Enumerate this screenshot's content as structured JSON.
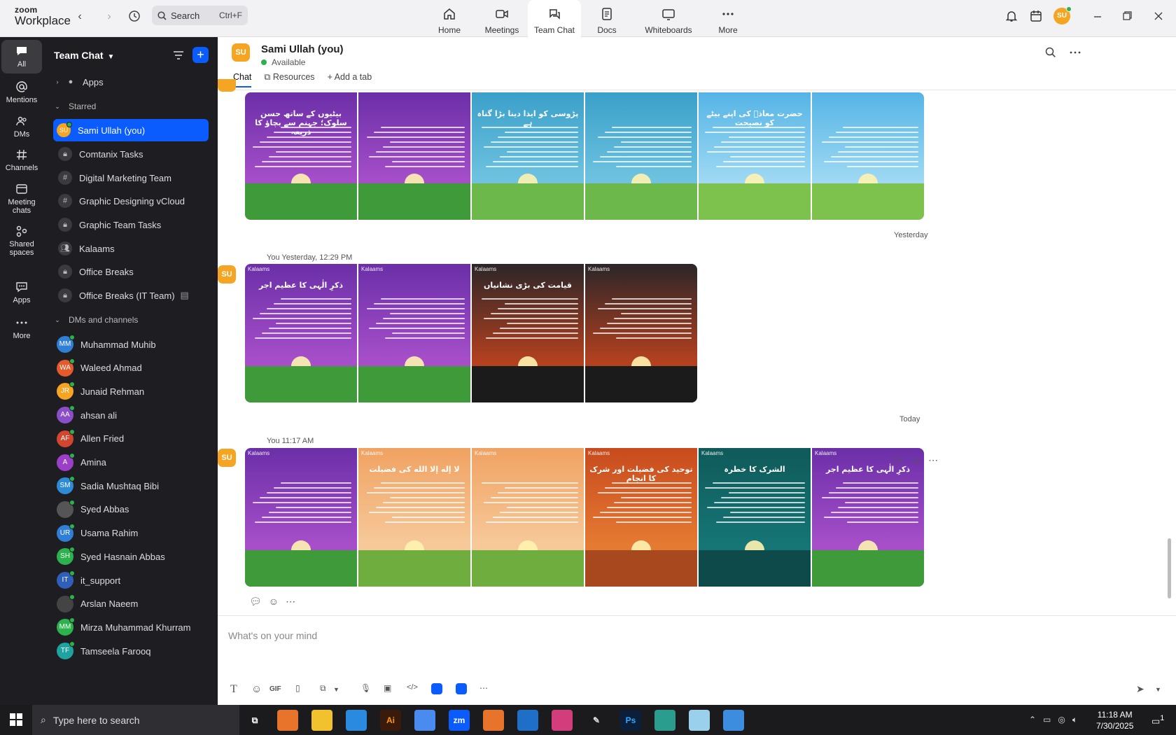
{
  "brand": {
    "line1": "zoom",
    "line2": "Workplace"
  },
  "search": {
    "label": "Search",
    "shortcut": "Ctrl+F"
  },
  "nav_tabs": [
    {
      "label": "Home",
      "icon": "home-icon"
    },
    {
      "label": "Meetings",
      "icon": "video-icon"
    },
    {
      "label": "Team Chat",
      "icon": "chat-icon"
    },
    {
      "label": "Docs",
      "icon": "doc-icon"
    },
    {
      "label": "Whiteboards",
      "icon": "whiteboard-icon"
    },
    {
      "label": "More",
      "icon": "more-icon"
    }
  ],
  "profile_initials": "SU",
  "rail": [
    {
      "label": "All"
    },
    {
      "label": "Mentions"
    },
    {
      "label": "DMs"
    },
    {
      "label": "Channels"
    },
    {
      "label": "Meeting chats"
    },
    {
      "label": "Shared spaces"
    },
    {
      "label": "Apps"
    },
    {
      "label": "More"
    }
  ],
  "sidebar": {
    "title": "Team Chat",
    "apps_label": "Apps",
    "starred_label": "Starred",
    "starred": [
      {
        "label": "Sami Ullah (you)",
        "initials": "SU"
      },
      {
        "label": "Comtanix Tasks"
      },
      {
        "label": "Digital Marketing Team"
      },
      {
        "label": "Graphic Designing vCloud"
      },
      {
        "label": "Graphic Team Tasks"
      },
      {
        "label": "Kalaams"
      },
      {
        "label": "Office Breaks"
      },
      {
        "label": "Office Breaks (IT Team)"
      }
    ],
    "dm_label": "DMs and channels",
    "dms": [
      {
        "label": "Muhammad Muhib",
        "initials": "MM",
        "color": "#2f7fd6"
      },
      {
        "label": "Waleed Ahmad",
        "initials": "WA",
        "color": "#e55a2b"
      },
      {
        "label": "Junaid Rehman",
        "initials": "JR",
        "color": "#f5a521"
      },
      {
        "label": "ahsan ali",
        "initials": "AA",
        "color": "#8a4fc8"
      },
      {
        "label": "Allen Fried",
        "initials": "AF",
        "color": "#d2452f"
      },
      {
        "label": "Amina",
        "initials": "A",
        "color": "#9b3fc9"
      },
      {
        "label": "Sadia Mushtaq Bibi",
        "initials": "SM",
        "color": "#2f8ad6"
      },
      {
        "label": "Syed Abbas",
        "initials": "",
        "color": "#555"
      },
      {
        "label": "Usama Rahim",
        "initials": "UR",
        "color": "#2f7fd6"
      },
      {
        "label": "Syed Hasnain Abbas",
        "initials": "SH",
        "color": "#2bb24c"
      },
      {
        "label": "it_support",
        "initials": "IT",
        "color": "#2f5fb8"
      },
      {
        "label": "Arslan Naeem",
        "initials": "",
        "color": "#444"
      },
      {
        "label": "Mirza Muhammad Khurram",
        "initials": "MM",
        "color": "#2bb24c"
      },
      {
        "label": "Tamseela Farooq",
        "initials": "TF",
        "color": "#1fa3a0"
      }
    ]
  },
  "chat": {
    "name": "Sami Ullah (you)",
    "initials": "SU",
    "status": "Available",
    "tabs": [
      "Chat",
      "Resources",
      "Add a tab"
    ],
    "dates": [
      "Yesterday",
      "Today"
    ],
    "messages": [
      {
        "meta": "",
        "cards": [
          {
            "title": "بیٹیوں کے ساتھ حسن سلوک؛ جہنم سے بچاؤ کا ذریعہ",
            "theme": "purple"
          },
          {
            "title": "",
            "theme": "purple"
          },
          {
            "title": "پڑوسی کو ایذا دینا بڑا گناہ ہے",
            "theme": "blue"
          },
          {
            "title": "",
            "theme": "blue"
          },
          {
            "title": "حضرت معاذؓ کی اپنے بیٹے کو نصیحت",
            "theme": "sky"
          },
          {
            "title": "",
            "theme": "sky"
          }
        ]
      },
      {
        "meta": "You Yesterday, 12:29 PM",
        "cards": [
          {
            "title": "ذکرِ الٰہی کا عظیم اجر",
            "theme": "purple"
          },
          {
            "title": "",
            "theme": "purple"
          },
          {
            "title": "قیامت کی بڑی نشانیاں",
            "theme": "dark"
          },
          {
            "title": "",
            "theme": "dark"
          }
        ]
      },
      {
        "meta": "You 11:17 AM",
        "cards": [
          {
            "title": "",
            "theme": "purple"
          },
          {
            "title": "لا إله إلا الله کی فضیلت",
            "theme": "orange"
          },
          {
            "title": "",
            "theme": "orange"
          },
          {
            "title": "توحید کی فضیلت اور شرک کا انجام",
            "theme": "desert"
          },
          {
            "title": "الشرک کا خطرہ",
            "theme": "teal"
          },
          {
            "title": "ذکرِ الٰہی کا عظیم اجر",
            "theme": "purple"
          }
        ]
      }
    ],
    "card_logo": "Kalaams",
    "composer_placeholder": "What's on your mind",
    "composer_tools": [
      "T",
      "☺",
      "GIF"
    ]
  },
  "taskbar": {
    "search": "Type here to search",
    "time": "11:18 AM",
    "date": "7/30/2025",
    "notif": "1"
  }
}
